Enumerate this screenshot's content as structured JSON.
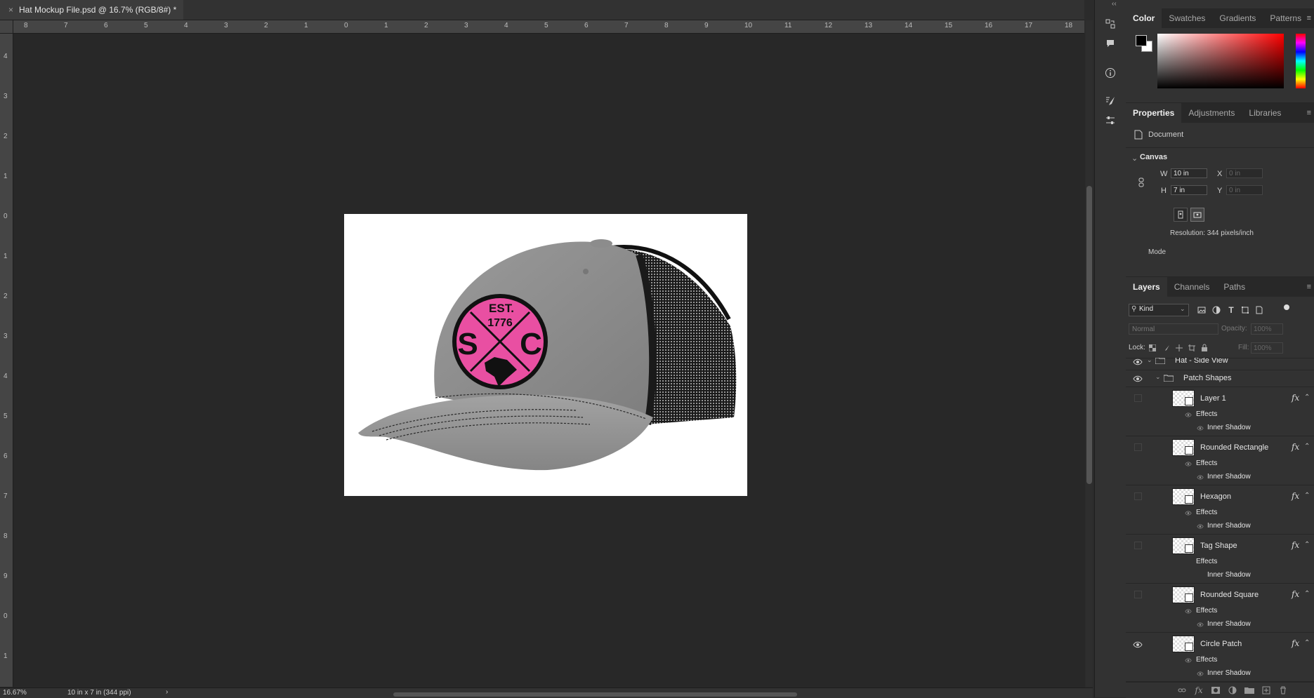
{
  "document": {
    "tab_title": "Hat Mockup File.psd @ 16.7% (RGB/8#) *",
    "close_glyph": "×",
    "ruler_top_labels": [
      "8",
      "7",
      "6",
      "5",
      "4",
      "3",
      "2",
      "1",
      "0",
      "1",
      "2",
      "3",
      "4",
      "5",
      "6",
      "7",
      "8",
      "9",
      "10",
      "11",
      "12",
      "13",
      "14",
      "15",
      "16",
      "17",
      "18"
    ],
    "ruler_left_labels": [
      "4",
      "3",
      "2",
      "1",
      "0",
      "1",
      "2",
      "3",
      "4",
      "5",
      "6",
      "7",
      "8",
      "9",
      "0",
      "1"
    ],
    "status_zoom": "16.67%",
    "status_info": "10 in x 7 in (344 ppi)",
    "status_arrow": "›",
    "patch": {
      "est_text": "EST.",
      "year_text": "1776",
      "left_letter": "S",
      "right_letter": "C",
      "color": "#e94fa2"
    }
  },
  "side_strip": {
    "collapse_glyph": "‹‹",
    "icons": [
      "layer-comps-icon",
      "comment-icon",
      "info-icon",
      "brush-settings-icon",
      "adjustments-sliders-icon"
    ]
  },
  "color_panel": {
    "tabs": [
      "Color",
      "Swatches",
      "Gradients",
      "Patterns"
    ],
    "active_tab": "Color",
    "foreground": "#000000",
    "background": "#ffffff",
    "hue_base": "#ff0000"
  },
  "properties_panel": {
    "tabs": [
      "Properties",
      "Adjustments",
      "Libraries"
    ],
    "active_tab": "Properties",
    "document_label": "Document",
    "canvas_section": "Canvas",
    "w_label": "W",
    "w_value": "10 in",
    "h_label": "H",
    "h_value": "7 in",
    "x_label": "X",
    "x_placeholder": "0 in",
    "y_label": "Y",
    "y_placeholder": "0 in",
    "resolution": "Resolution: 344 pixels/inch",
    "mode_label": "Mode"
  },
  "layers_panel": {
    "tabs": [
      "Layers",
      "Channels",
      "Paths"
    ],
    "active_tab": "Layers",
    "filter_value": "Kind",
    "blend_mode": "Normal",
    "opacity_label": "Opacity:",
    "opacity_value": "100%",
    "lock_label": "Lock:",
    "fill_label": "Fill:",
    "fill_value": "100%",
    "group_top": "Hat - Side View",
    "group_patch": "Patch Shapes",
    "effects_label": "Effects",
    "inner_shadow_label": "Inner Shadow",
    "fx_label": "fx",
    "layers": [
      {
        "name": "Layer 1",
        "visible": false
      },
      {
        "name": "Rounded Rectangle",
        "visible": false
      },
      {
        "name": "Hexagon",
        "visible": false
      },
      {
        "name": "Tag Shape",
        "visible": false
      },
      {
        "name": "Rounded Square",
        "visible": false
      },
      {
        "name": "Circle Patch",
        "visible": true
      }
    ]
  }
}
